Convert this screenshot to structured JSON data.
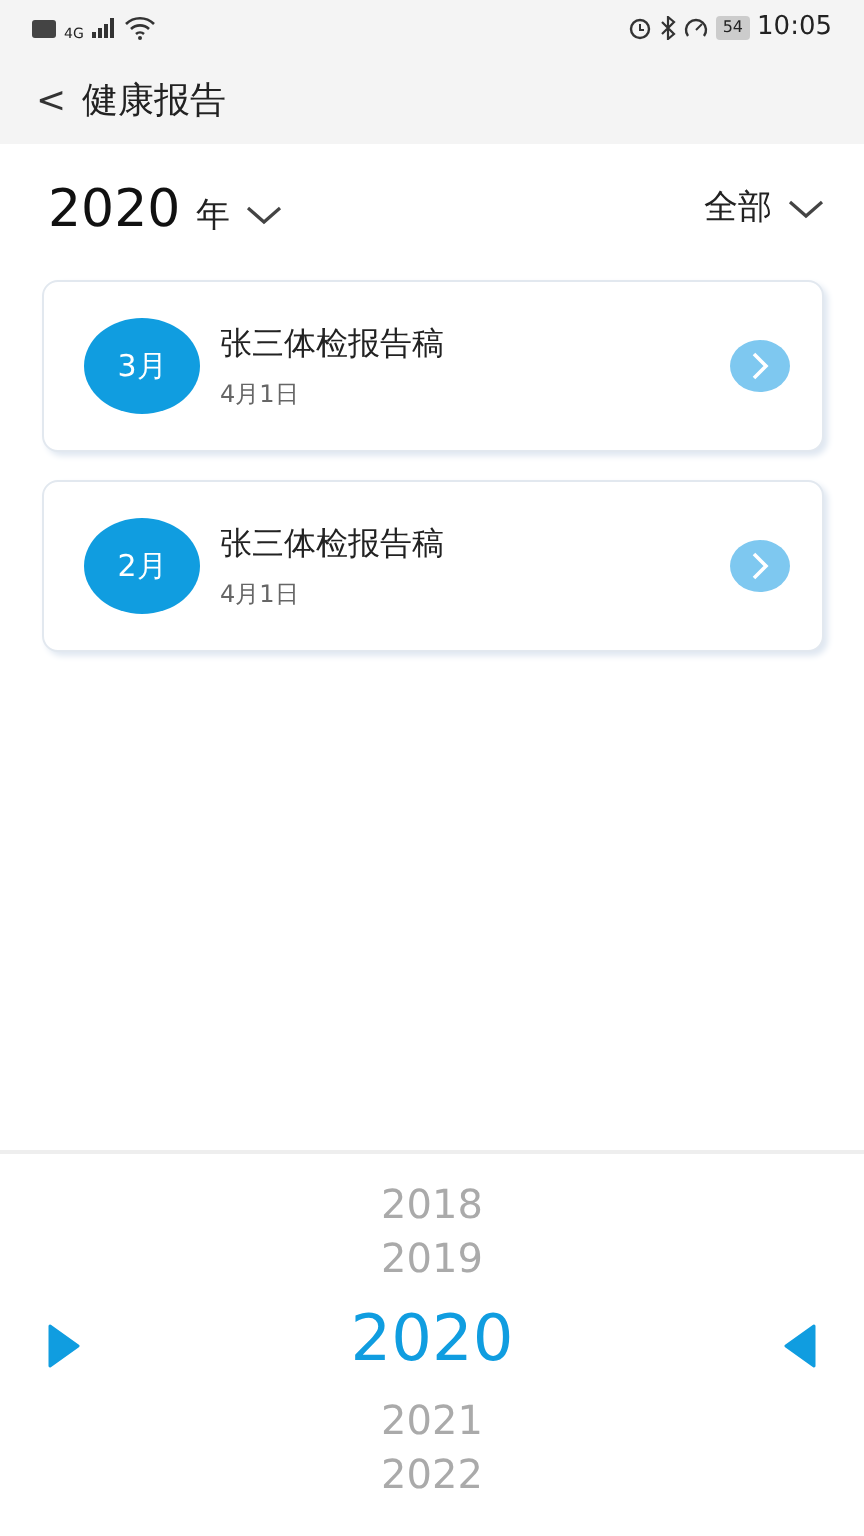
{
  "status_bar": {
    "network": "4G",
    "battery": "54",
    "time": "10:05"
  },
  "header": {
    "back": "<",
    "title": "健康报告"
  },
  "filter": {
    "year": "2020",
    "year_unit": "年",
    "category": "全部"
  },
  "reports": [
    {
      "month": "3月",
      "title": "张三体检报告稿",
      "date": "4月1日"
    },
    {
      "month": "2月",
      "title": "张三体检报告稿",
      "date": "4月1日"
    }
  ],
  "year_picker": [
    {
      "label": "2018",
      "selected": false
    },
    {
      "label": "2019",
      "selected": false
    },
    {
      "label": "2020",
      "selected": true
    },
    {
      "label": "2021",
      "selected": false
    },
    {
      "label": "2022",
      "selected": false
    }
  ]
}
